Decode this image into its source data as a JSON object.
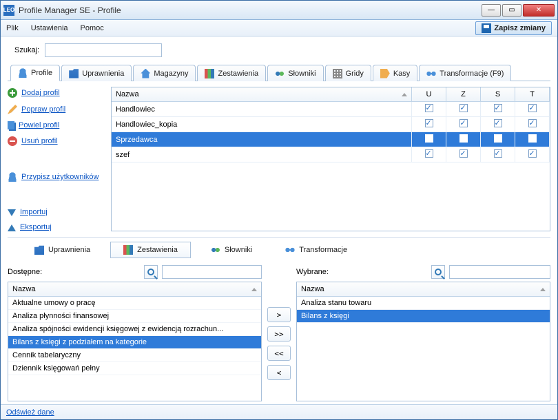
{
  "window": {
    "title": "Profile Manager SE - Profile"
  },
  "menu": {
    "file": "Plik",
    "settings": "Ustawienia",
    "help": "Pomoc",
    "save": "Zapisz zmiany"
  },
  "search": {
    "label": "Szukaj:"
  },
  "tabs": {
    "profile": "Profile",
    "permissions": "Uprawnienia",
    "warehouses": "Magazyny",
    "reports": "Zestawienia",
    "dicts": "Słowniki",
    "grids": "Gridy",
    "cash": "Kasy",
    "transforms": "Transformacje (F9)"
  },
  "side": {
    "add": "Dodaj profil",
    "edit": "Popraw profil",
    "dup": "Powiel profil",
    "del": "Usuń profil",
    "assign": "Przypisz użytkowników",
    "import": "Importuj",
    "export": "Eksportuj"
  },
  "profiles": {
    "headers": {
      "name": "Nazwa",
      "u": "U",
      "z": "Z",
      "s": "S",
      "t": "T"
    },
    "rows": [
      {
        "name": "Handlowiec",
        "u": true,
        "z": true,
        "s": true,
        "t": true,
        "selected": false
      },
      {
        "name": "Handlowiec_kopia",
        "u": true,
        "z": true,
        "s": true,
        "t": true,
        "selected": false
      },
      {
        "name": "Sprzedawca",
        "u": true,
        "z": true,
        "s": true,
        "t": false,
        "selected": true
      },
      {
        "name": "szef",
        "u": true,
        "z": true,
        "s": true,
        "t": true,
        "selected": false
      }
    ]
  },
  "subtabs": {
    "permissions": "Uprawnienia",
    "reports": "Zestawienia",
    "dicts": "Słowniki",
    "transforms": "Transformacje"
  },
  "available": {
    "label": "Dostępne:",
    "header": "Nazwa",
    "items": [
      {
        "label": "Aktualne umowy o pracę",
        "selected": false
      },
      {
        "label": "Analiza płynności finansowej",
        "selected": false
      },
      {
        "label": "Analiza spójności ewidencji księgowej z ewidencją rozrachun...",
        "selected": false
      },
      {
        "label": "Bilans z księgi z podziałem na kategorie",
        "selected": true
      },
      {
        "label": "Cennik tabelaryczny",
        "selected": false
      },
      {
        "label": "Dziennik księgowań pełny",
        "selected": false
      }
    ]
  },
  "selected": {
    "label": "Wybrane:",
    "header": "Nazwa",
    "items": [
      {
        "label": "Analiza stanu towaru",
        "selected": false
      },
      {
        "label": "Bilans z księgi",
        "selected": true
      }
    ]
  },
  "transfer": {
    "right": ">",
    "all_right": ">>",
    "all_left": "<<",
    "left": "<"
  },
  "status": {
    "refresh": "Odśwież dane"
  }
}
